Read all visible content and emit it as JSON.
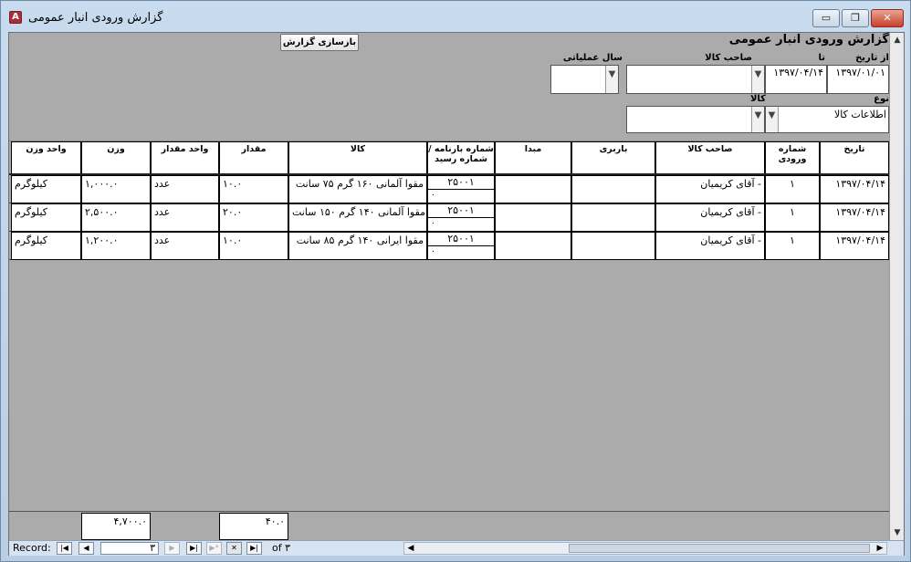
{
  "window": {
    "title": "گزارش ورودی انبار عمومی",
    "icon": "access-form-icon",
    "controls": {
      "minimize": "▭",
      "restore": "❐",
      "close": "✕"
    }
  },
  "header": {
    "rebuild_button": "بازسازی گزارش",
    "page_title": "گزارش ورودی انبار عمومی",
    "from_date_label": "از تاریخ",
    "from_date_value": "۱۳۹۷/۰۱/۰۱",
    "to_label": "تا",
    "to_date_value": "۱۳۹۷/۰۴/۱۴",
    "owner_label": "صاحب کالا",
    "owner_value": "",
    "fiscal_year_label": "سال عملیاتی",
    "fiscal_year_value": "",
    "type_label": "نوع",
    "type_value": "اطلاعات کالا",
    "goods_label": "کالا",
    "goods_value": ""
  },
  "columns": {
    "date": "تاریخ",
    "entry_no": "شماره ورودی",
    "owner": "صاحب کالا",
    "carrier": "باربری",
    "origin": "مبدا",
    "waybill": "شماره بارنامه / شماره رسید",
    "goods": "کالا",
    "qty": "مقدار",
    "qty_unit": "واحد مقدار",
    "weight": "وزن",
    "weight_unit": "واحد وزن"
  },
  "rows": [
    {
      "date": "۱۳۹۷/۰۴/۱۴",
      "entry_no": "۱",
      "owner": "آقای کریمیان -",
      "carrier": "",
      "origin": "",
      "waybill": "۲۵۰۰۱",
      "receipt": "۰",
      "goods": "مقوا آلمانی ۱۶۰ گرم ۷۵ سانت",
      "qty": "۱۰.۰",
      "qty_unit": "عدد",
      "weight": "۱,۰۰۰.۰",
      "weight_unit": "کیلوگرم"
    },
    {
      "date": "۱۳۹۷/۰۴/۱۴",
      "entry_no": "۱",
      "owner": "آقای کریمیان -",
      "carrier": "",
      "origin": "",
      "waybill": "۲۵۰۰۱",
      "receipt": "۰",
      "goods": "مقوا آلمانی ۱۴۰ گرم ۱۵۰ سانت",
      "qty": "۲۰.۰",
      "qty_unit": "عدد",
      "weight": "۲,۵۰۰.۰",
      "weight_unit": "کیلوگرم"
    },
    {
      "date": "۱۳۹۷/۰۴/۱۴",
      "entry_no": "۱",
      "owner": "آقای کریمیان -",
      "carrier": "",
      "origin": "",
      "waybill": "۲۵۰۰۱",
      "receipt": "۰",
      "goods": "مقوا ایرانی ۱۴۰ گرم ۸۵ سانت",
      "qty": "۱۰.۰",
      "qty_unit": "عدد",
      "weight": "۱,۲۰۰.۰",
      "weight_unit": "کیلوگرم"
    }
  ],
  "totals": {
    "weight": "۴,۷۰۰.۰",
    "qty": "۴۰.۰"
  },
  "navigation": {
    "record_label": "Record:",
    "current": "۳",
    "of_label": "of",
    "total": "۳"
  }
}
